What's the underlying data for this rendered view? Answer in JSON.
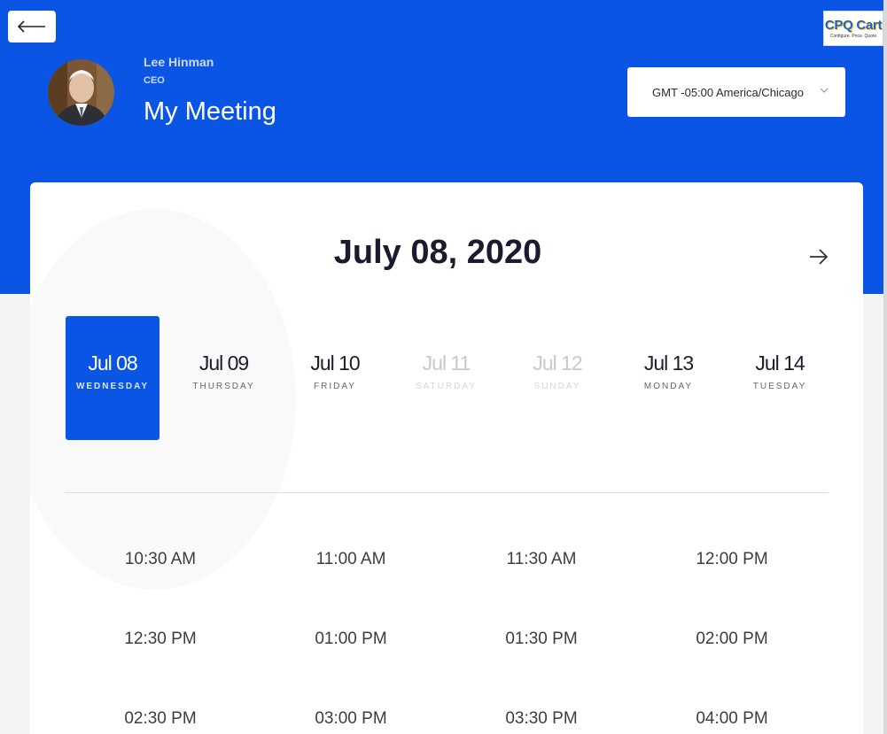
{
  "header": {
    "host_name": "Lee Hinman",
    "host_role": "CEO",
    "meeting_title": "My Meeting",
    "timezone": "GMT -05:00 America/Chicago",
    "logo_text": "CPQ Cart",
    "logo_tagline": "Configure. Price. Quote",
    "brand_color": "#0b55e4"
  },
  "icons": {
    "back": "arrow-left-icon",
    "next": "arrow-right-icon",
    "dropdown": "chevron-down-icon"
  },
  "calendar": {
    "current_date": "July 08, 2020",
    "days": [
      {
        "date": "Jul 08",
        "weekday": "WEDNESDAY",
        "state": "selected"
      },
      {
        "date": "Jul 09",
        "weekday": "THURSDAY",
        "state": "available"
      },
      {
        "date": "Jul 10",
        "weekday": "FRIDAY",
        "state": "available"
      },
      {
        "date": "Jul 11",
        "weekday": "SATURDAY",
        "state": "disabled"
      },
      {
        "date": "Jul 12",
        "weekday": "SUNDAY",
        "state": "disabled"
      },
      {
        "date": "Jul 13",
        "weekday": "MONDAY",
        "state": "available"
      },
      {
        "date": "Jul 14",
        "weekday": "TUESDAY",
        "state": "available"
      }
    ]
  },
  "time_slots": [
    "10:30 AM",
    "11:00 AM",
    "11:30 AM",
    "12:00 PM",
    "12:30 PM",
    "01:00 PM",
    "01:30 PM",
    "02:00 PM",
    "02:30 PM",
    "03:00 PM",
    "03:30 PM",
    "04:00 PM"
  ]
}
